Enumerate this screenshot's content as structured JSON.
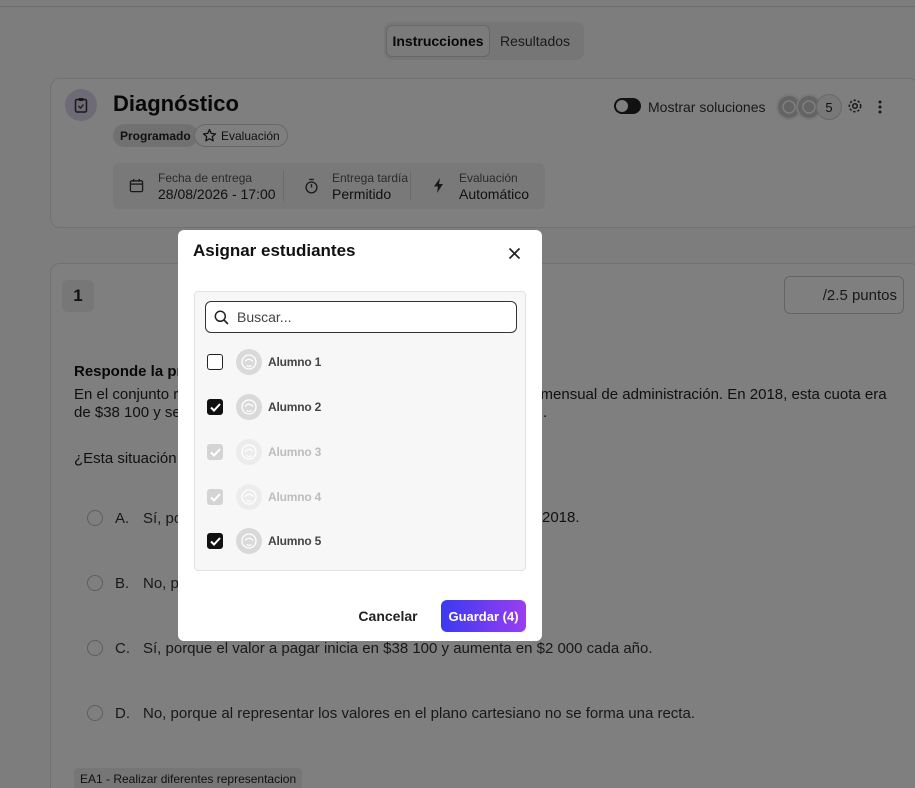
{
  "tabs": [
    {
      "label": "Instrucciones",
      "active": true
    },
    {
      "label": "Resultados",
      "active": false
    }
  ],
  "assignment": {
    "title": "Diagnóstico",
    "status_chip": "Programado",
    "type_chip": "Evaluación",
    "show_solutions_label": "Mostrar soluciones",
    "assignee_count": "5",
    "info": {
      "due_label": "Fecha de entrega",
      "due_value": "28/08/2026 - 17:00",
      "late_label": "Entrega tardía",
      "late_value": "Permitido",
      "eval_label": "Evaluación",
      "eval_value": "Automático"
    }
  },
  "question": {
    "number": "1",
    "points": "/2.5 puntos",
    "heading": "Responde la preg",
    "line1_left": "En el conjunto re",
    "line1_right": "a mensual de administración. En 2018, esta cuota era",
    "line2_left": "de $38 100 y se",
    "line2_right": ").",
    "prompt": "¿Esta situación se",
    "options": [
      {
        "letter": "A.",
        "text": "Sí, por",
        "tail": "2018."
      },
      {
        "letter": "B.",
        "text": "No, po",
        "tail": ""
      },
      {
        "letter": "C.",
        "text": "Sí, porque el valor a pagar inicia en $38 100 y aumenta en $2 000 cada año.",
        "tail": ""
      },
      {
        "letter": "D.",
        "text": "No, porque al representar los valores en el plano cartesiano no se forma una recta.",
        "tail": ""
      }
    ],
    "tag": "EA1 - Realizar diferentes representacion"
  },
  "modal": {
    "title": "Asignar estudiantes",
    "search_placeholder": "Buscar...",
    "students": [
      {
        "name": "Alumno 1",
        "checked": false,
        "disabled": false
      },
      {
        "name": "Alumno 2",
        "checked": true,
        "disabled": false
      },
      {
        "name": "Alumno 3",
        "checked": true,
        "disabled": true
      },
      {
        "name": "Alumno 4",
        "checked": true,
        "disabled": true
      },
      {
        "name": "Alumno 5",
        "checked": true,
        "disabled": false
      }
    ],
    "cancel_label": "Cancelar",
    "save_label": "Guardar (4)"
  },
  "colors": {
    "save_gradient_start": "#3a3af0",
    "save_gradient_end": "#9b3df0",
    "overlay": "rgba(0,0,0,0.5)"
  }
}
